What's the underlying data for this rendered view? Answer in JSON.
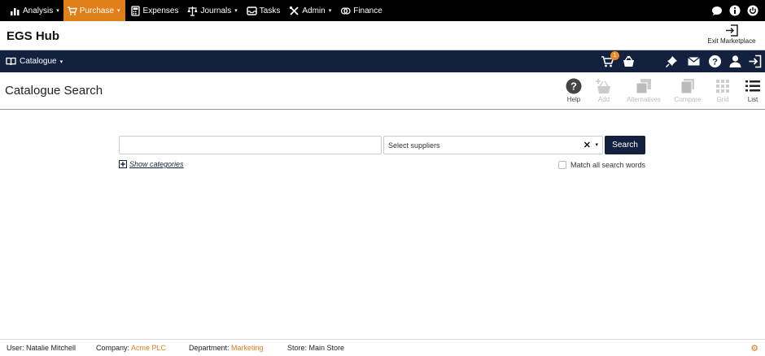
{
  "topnav": {
    "items": [
      {
        "label": "Analysis",
        "icon": "bar-chart-icon",
        "has_menu": true
      },
      {
        "label": "Purchase",
        "icon": "cart-icon",
        "has_menu": true,
        "active": true
      },
      {
        "label": "Expenses",
        "icon": "calculator-icon",
        "has_menu": false
      },
      {
        "label": "Journals",
        "icon": "scales-icon",
        "has_menu": true
      },
      {
        "label": "Tasks",
        "icon": "inbox-icon",
        "has_menu": false
      },
      {
        "label": "Admin",
        "icon": "tools-icon",
        "has_menu": true
      },
      {
        "label": "Finance",
        "icon": "coins-icon",
        "has_menu": false
      }
    ],
    "caret": "▾",
    "right_icons": [
      "chat-icon",
      "info-icon",
      "power-icon"
    ],
    "active_color": "#e07f1a"
  },
  "hub": {
    "title": "EGS Hub",
    "exit_label": "Exit Marketplace"
  },
  "catbar": {
    "menu_label": "Catalogue",
    "caret": "▾",
    "cart_badge": "1",
    "icons": [
      "cart-icon",
      "basket-icon",
      "pin-icon",
      "mail-icon",
      "help-icon",
      "user-icon",
      "logout-icon"
    ],
    "background": "#13213f"
  },
  "page": {
    "title": "Catalogue Search",
    "tools": [
      {
        "label": "Help",
        "icon": "help-icon",
        "enabled": true
      },
      {
        "label": "Add",
        "icon": "add-to-basket-icon",
        "enabled": false
      },
      {
        "label": "Alternatives",
        "icon": "alternatives-icon",
        "enabled": false
      },
      {
        "label": "Compare",
        "icon": "compare-icon",
        "enabled": false
      },
      {
        "label": "Grid",
        "icon": "grid-icon",
        "enabled": false
      },
      {
        "label": "List",
        "icon": "list-icon",
        "enabled": true
      }
    ]
  },
  "search": {
    "input_value": "",
    "input_placeholder": "",
    "supplier_placeholder": "Select suppliers",
    "clear_symbol": "✕",
    "dropdown_symbol": "▾",
    "button_label": "Search",
    "show_categories_label": "Show categories",
    "show_categories_symbol": "+",
    "match_all_label": "Match all search words",
    "match_all_checked": false
  },
  "footer": {
    "user_label": "User:",
    "user_value": "Natalie Mitchell",
    "company_label": "Company:",
    "company_value": "Acme PLC",
    "department_label": "Department:",
    "department_value": "Marketing",
    "store_label": "Store:",
    "store_value": "Main Store",
    "settings_icon": "gear-icon"
  }
}
